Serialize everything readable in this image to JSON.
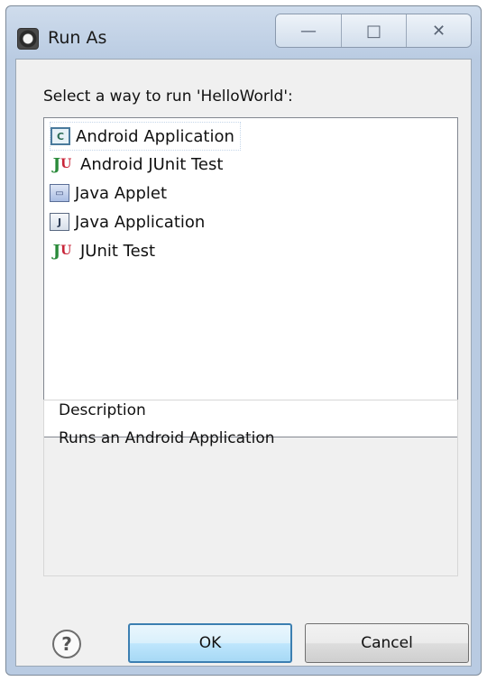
{
  "window": {
    "title": "Run As",
    "caption_buttons": {
      "minimize": "—",
      "maximize": "□",
      "close": "✕"
    }
  },
  "prompt": "Select a way to run 'HelloWorld':",
  "run_options": [
    {
      "label": "Android Application",
      "icon": "android-application-icon",
      "selected": true
    },
    {
      "label": "Android JUnit Test",
      "icon": "android-junit-icon",
      "selected": false
    },
    {
      "label": "Java Applet",
      "icon": "java-applet-icon",
      "selected": false
    },
    {
      "label": "Java Application",
      "icon": "java-application-icon",
      "selected": false
    },
    {
      "label": "JUnit Test",
      "icon": "junit-icon",
      "selected": false
    }
  ],
  "description": {
    "title": "Description",
    "text": "Runs an Android Application"
  },
  "buttons": {
    "help": "?",
    "ok": "OK",
    "cancel": "Cancel"
  }
}
